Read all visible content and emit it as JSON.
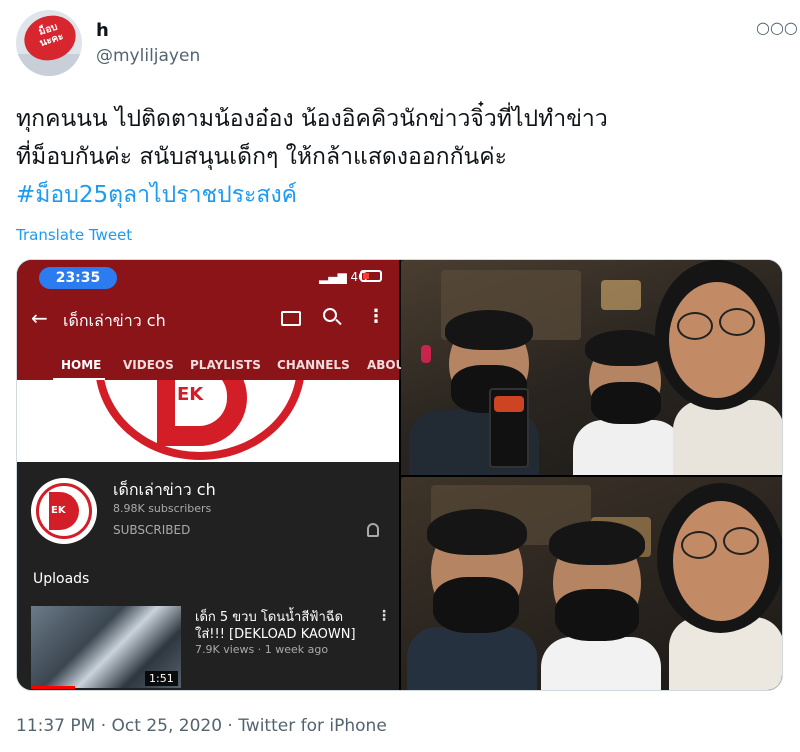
{
  "author": {
    "name": "h",
    "handle": "@myliljayen",
    "avatar_text": "ม็อบ นะคะ"
  },
  "tweet": {
    "lines": [
      "ทุกคนนน ไปติดตามน้องอ๋อง น้องอิคคิวนักข่าวจิ๋วที่ไปทำข่าว",
      "ที่ม็อบกันค่ะ สนับสนุนเด็กๆ ให้กล้าแสดงออกกันค่ะ"
    ],
    "hashtag": "#ม็อบ25ตุลาไปราชประสงค์",
    "translate_label": "Translate Tweet",
    "timestamp_line": "11:37 PM · Oct 25, 2020 · Twitter for iPhone"
  },
  "phone": {
    "time": "23:35",
    "network": "4G",
    "channel_title": "เด็กเล่าข่าว ch",
    "tabs": [
      "HOME",
      "VIDEOS",
      "PLAYLISTS",
      "CHANNELS",
      "ABOU"
    ],
    "banner_logo_text": "EK",
    "logo_text": "EK",
    "channel_name": "เด็กเล่าข่าว ch",
    "subscribers": "8.98K subscribers",
    "subscribed_label": "SUBSCRIBED",
    "uploads_label": "Uploads",
    "video": {
      "title": "เด็ก 5 ขวบ โดนน้ำสีฟ้าฉีด ใส่!!! [DEKLOAD KAOWN]",
      "meta": "7.9K views · 1 week ago",
      "duration": "1:51"
    }
  },
  "colors": {
    "youtube_header": "#8b1418",
    "brand_red": "#d41e27",
    "link_blue": "#1d9bf0",
    "muted_text": "#536471"
  },
  "icons": {
    "more": "more-horizontal-icon",
    "back": "back-arrow-icon",
    "cast": "cast-icon",
    "search": "search-icon",
    "menu": "kebab-menu-icon",
    "bell": "bell-icon"
  }
}
